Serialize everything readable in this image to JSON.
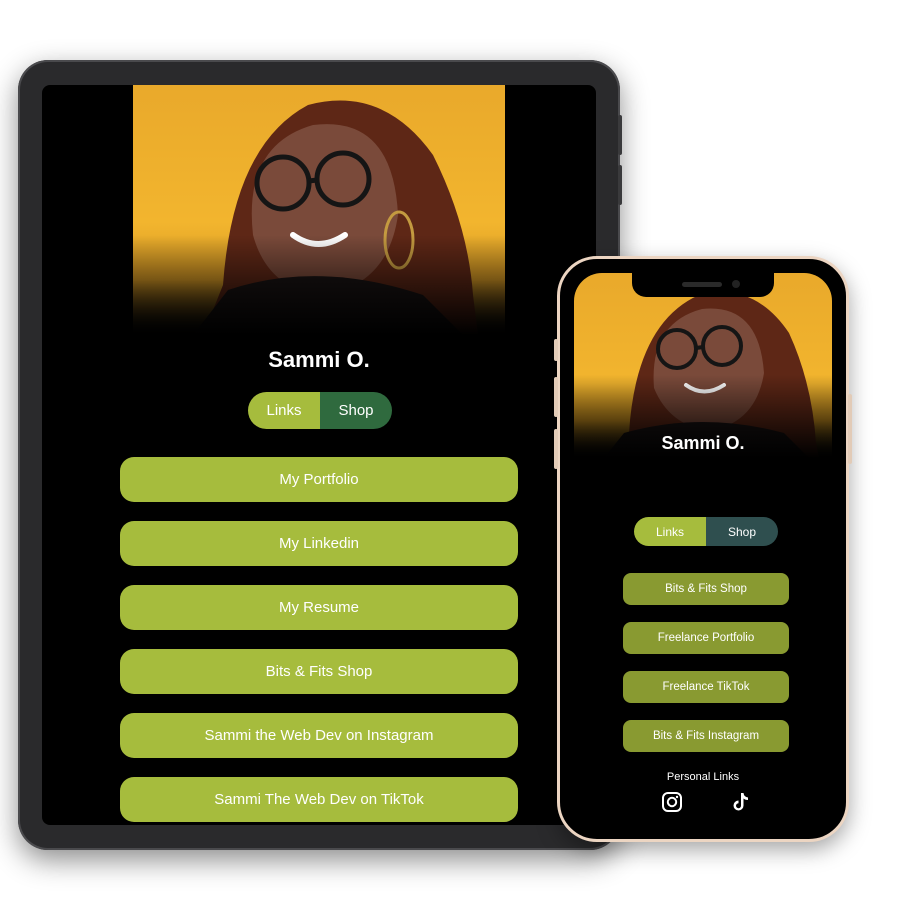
{
  "tablet": {
    "profile": {
      "name": "Sammi O."
    },
    "toggle": {
      "links_label": "Links",
      "shop_label": "Shop"
    },
    "links": [
      "My Portfolio",
      "My Linkedin",
      "My Resume",
      "Bits & Fits Shop",
      "Sammi the Web Dev on Instagram",
      "Sammi The Web Dev on TikTok"
    ]
  },
  "phone": {
    "profile": {
      "name": "Sammi O."
    },
    "toggle": {
      "links_label": "Links",
      "shop_label": "Shop"
    },
    "links": [
      "Bits & Fits Shop",
      "Freelance Portfolio",
      "Freelance TikTok",
      "Bits & Fits Instagram"
    ],
    "personal_links_label": "Personal Links",
    "social_icons": [
      "instagram-icon",
      "tiktok-icon"
    ]
  },
  "colors": {
    "accent_green": "#a6bc3d",
    "shop_green_tablet": "#2f6a3e",
    "shop_teal_phone": "#2f4f4f",
    "phone_link_green": "#899a31",
    "photo_bg_yellow": "#f2b52e",
    "background": "#000000"
  }
}
